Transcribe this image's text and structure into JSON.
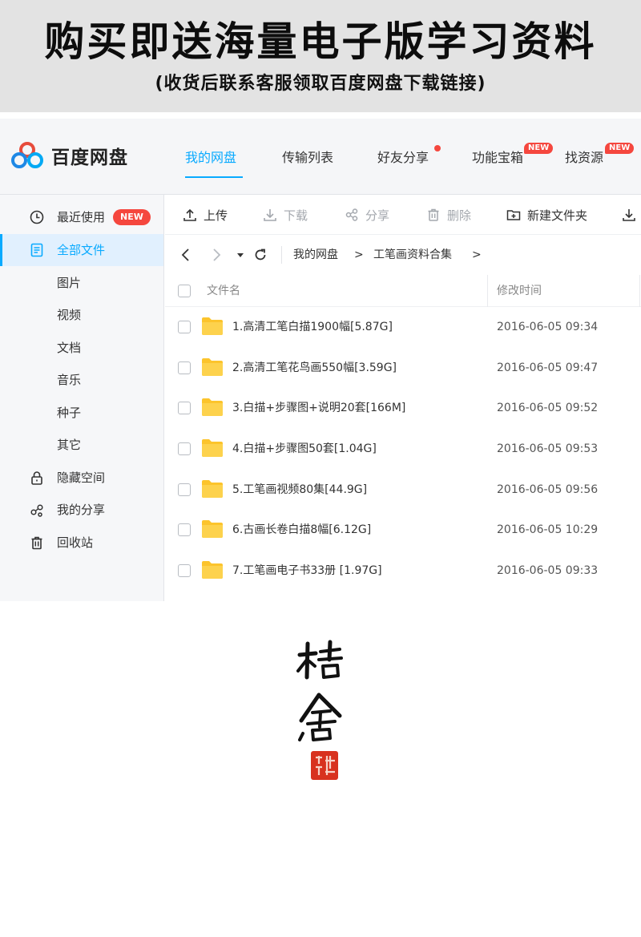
{
  "banner": {
    "title": "购买即送海量电子版学习资料",
    "subtitle": "(收货后联系客服领取百度网盘下载链接)"
  },
  "app": {
    "name": "百度网盘",
    "accent": "#09aaff",
    "alert": "#f5473e",
    "nav": [
      {
        "label": "我的网盘",
        "active": true
      },
      {
        "label": "传输列表"
      },
      {
        "label": "好友分享",
        "dot": true
      },
      {
        "label": "功能宝箱",
        "badge": "NEW"
      },
      {
        "label": "找资源",
        "badge": "NEW"
      }
    ]
  },
  "sidebar": {
    "items": [
      {
        "label": "最近使用",
        "icon": "clock-icon",
        "badge": "NEW"
      },
      {
        "label": "全部文件",
        "icon": "document-icon",
        "active": true
      },
      {
        "label": "图片"
      },
      {
        "label": "视频"
      },
      {
        "label": "文档"
      },
      {
        "label": "音乐"
      },
      {
        "label": "种子"
      },
      {
        "label": "其它"
      },
      {
        "label": "隐藏空间",
        "icon": "lock-icon"
      },
      {
        "label": "我的分享",
        "icon": "share-icon"
      },
      {
        "label": "回收站",
        "icon": "trash-icon"
      }
    ]
  },
  "toolbar": {
    "upload": "上传",
    "download": "下载",
    "share": "分享",
    "delete": "删除",
    "new_folder": "新建文件夹"
  },
  "path": {
    "root": "我的网盘",
    "sep": ">",
    "current": "工笔画资料合集"
  },
  "list": {
    "col_name": "文件名",
    "col_time": "修改时间",
    "files": [
      {
        "name": "1.高清工笔白描1900幅[5.87G]",
        "time": "2016-06-05 09:34"
      },
      {
        "name": "2.高清工笔花鸟画550幅[3.59G]",
        "time": "2016-06-05 09:47"
      },
      {
        "name": "3.白描+步骤图+说明20套[166M]",
        "time": "2016-06-05 09:52"
      },
      {
        "name": "4.白描+步骤图50套[1.04G]",
        "time": "2016-06-05 09:53"
      },
      {
        "name": "5.工笔画视频80集[44.9G]",
        "time": "2016-06-05 09:56"
      },
      {
        "name": "6.古画长卷白描8幅[6.12G]",
        "time": "2016-06-05 10:29"
      },
      {
        "name": "7.工笔画电子书33册 [1.97G]",
        "time": "2016-06-05 09:33"
      }
    ]
  },
  "seal": {
    "signature": "桔舍",
    "stamp_color": "#d8321f"
  }
}
